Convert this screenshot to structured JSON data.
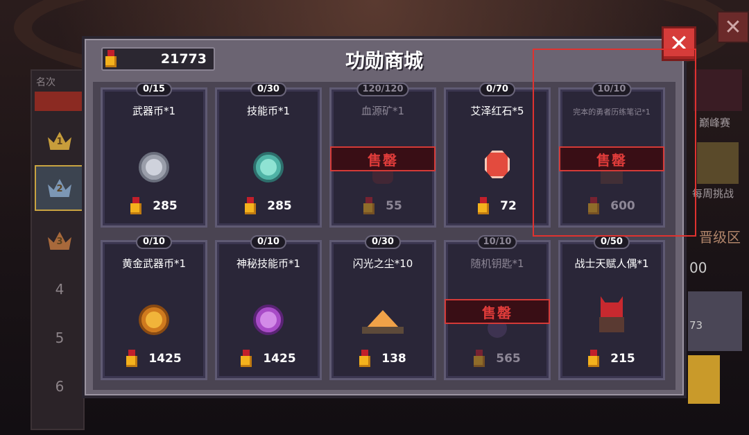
{
  "dialog": {
    "title": "功勋商城",
    "currency_value": "21773",
    "close_label": "✕"
  },
  "background": {
    "rank_header": "名次",
    "ranks": [
      "1",
      "2",
      "3",
      "4",
      "5",
      "6"
    ],
    "side_labels": [
      "巅峰赛",
      "每周挑战",
      "晋级区"
    ],
    "side_values": [
      "00",
      "73"
    ],
    "close_label": "✕"
  },
  "items": [
    {
      "limit": "0/15",
      "name": "武器币*1",
      "price": "285",
      "sold_out": false,
      "icon": "silver-weapon-coin-icon"
    },
    {
      "limit": "0/30",
      "name": "技能币*1",
      "price": "285",
      "sold_out": false,
      "icon": "teal-skill-coin-icon"
    },
    {
      "limit": "120/120",
      "name": "血源矿*1",
      "price": "55",
      "sold_out": true,
      "sold_label": "售罄",
      "icon": "blood-ore-icon"
    },
    {
      "limit": "0/70",
      "name": "艾泽红石*5",
      "price": "72",
      "sold_out": false,
      "icon": "red-gem-icon"
    },
    {
      "limit": "10/10",
      "name": "完本的勇者历练笔记*1",
      "price": "600",
      "sold_out": true,
      "sold_label": "售罄",
      "icon": "notebook-icon"
    },
    {
      "limit": "0/10",
      "name": "黄金武器币*1",
      "price": "1425",
      "sold_out": false,
      "icon": "gold-weapon-coin-icon"
    },
    {
      "limit": "0/10",
      "name": "神秘技能币*1",
      "price": "1425",
      "sold_out": false,
      "icon": "purple-skill-coin-icon"
    },
    {
      "limit": "0/30",
      "name": "闪光之尘*10",
      "price": "138",
      "sold_out": false,
      "icon": "shining-dust-icon"
    },
    {
      "limit": "10/10",
      "name": "随机钥匙*1",
      "price": "565",
      "sold_out": true,
      "sold_label": "售罄",
      "icon": "key-icon"
    },
    {
      "limit": "0/50",
      "name": "战士天赋人偶*1",
      "price": "215",
      "sold_out": false,
      "icon": "warrior-doll-icon"
    }
  ],
  "colors": {
    "accent_red": "#d63c3a",
    "medal_gold": "#f4b21d",
    "card_bg": "#2a2638",
    "dialog_bg": "#6b6472"
  }
}
